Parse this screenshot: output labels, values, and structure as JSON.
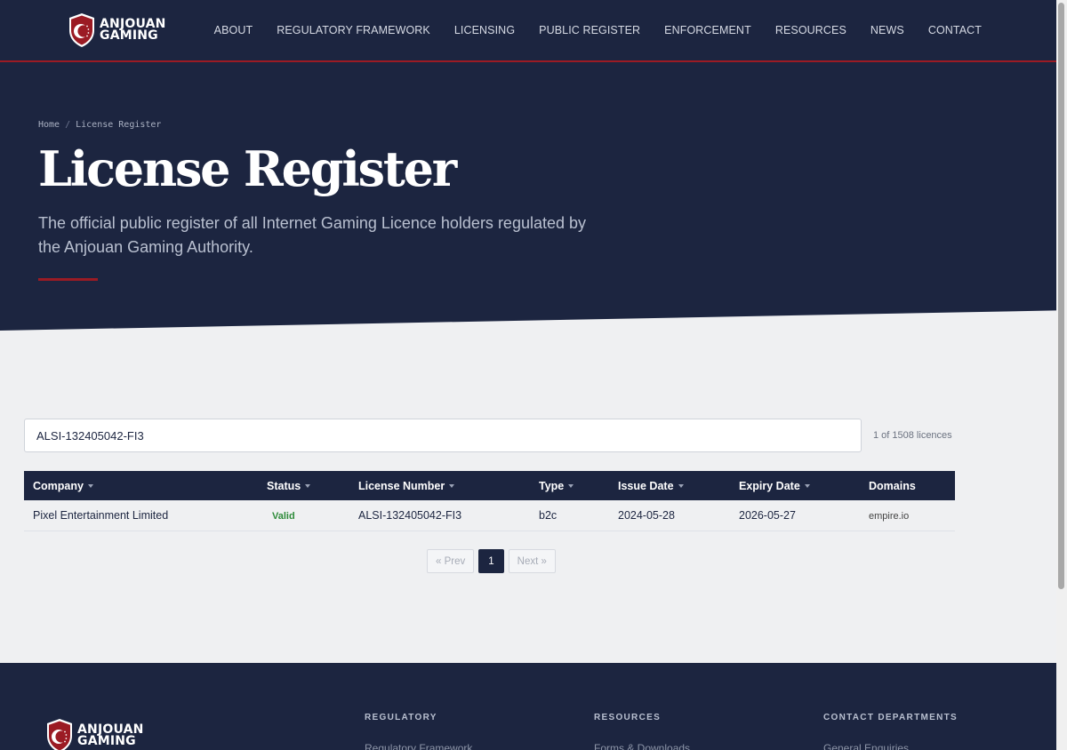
{
  "brand": {
    "line1": "ANJOUAN",
    "line2": "GAMING"
  },
  "nav": {
    "items": [
      {
        "label": "ABOUT"
      },
      {
        "label": "REGULATORY FRAMEWORK"
      },
      {
        "label": "LICENSING"
      },
      {
        "label": "PUBLIC REGISTER"
      },
      {
        "label": "ENFORCEMENT"
      },
      {
        "label": "RESOURCES"
      },
      {
        "label": "NEWS"
      },
      {
        "label": "CONTACT"
      }
    ]
  },
  "breadcrumb": {
    "home": "Home",
    "separator": "/",
    "current": "License Register"
  },
  "hero": {
    "title": "License Register",
    "subtitle": "The official public register of all Internet Gaming Licence holders regulated by the Anjouan Gaming Authority."
  },
  "search": {
    "value": "ALSI-132405042-FI3"
  },
  "count_text": "1 of 1508 licences",
  "table": {
    "headers": {
      "company": "Company",
      "status": "Status",
      "license_number": "License Number",
      "type": "Type",
      "issue_date": "Issue Date",
      "expiry_date": "Expiry Date",
      "domains": "Domains"
    },
    "rows": [
      {
        "company": "Pixel Entertainment Limited",
        "status": "Valid",
        "license_number": "ALSI-132405042-FI3",
        "type": "b2c",
        "issue_date": "2024-05-28",
        "expiry_date": "2026-05-27",
        "domains": "empire.io"
      }
    ]
  },
  "pagination": {
    "prev": "« Prev",
    "current": "1",
    "next": "Next »"
  },
  "footer": {
    "columns": [
      {
        "heading": "REGULATORY",
        "first_link": "Regulatory Framework"
      },
      {
        "heading": "RESOURCES",
        "first_link": "Forms & Downloads"
      },
      {
        "heading": "CONTACT DEPARTMENTS",
        "first_link": "General Enquiries"
      }
    ]
  },
  "colors": {
    "navy": "#1c2540",
    "accent_red": "#9b1b24",
    "valid_green": "#2e8b3a",
    "page_bg": "#eff0f2"
  },
  "icons": {
    "logo": "shield-crescent-icon",
    "sort": "caret-down-icon"
  }
}
